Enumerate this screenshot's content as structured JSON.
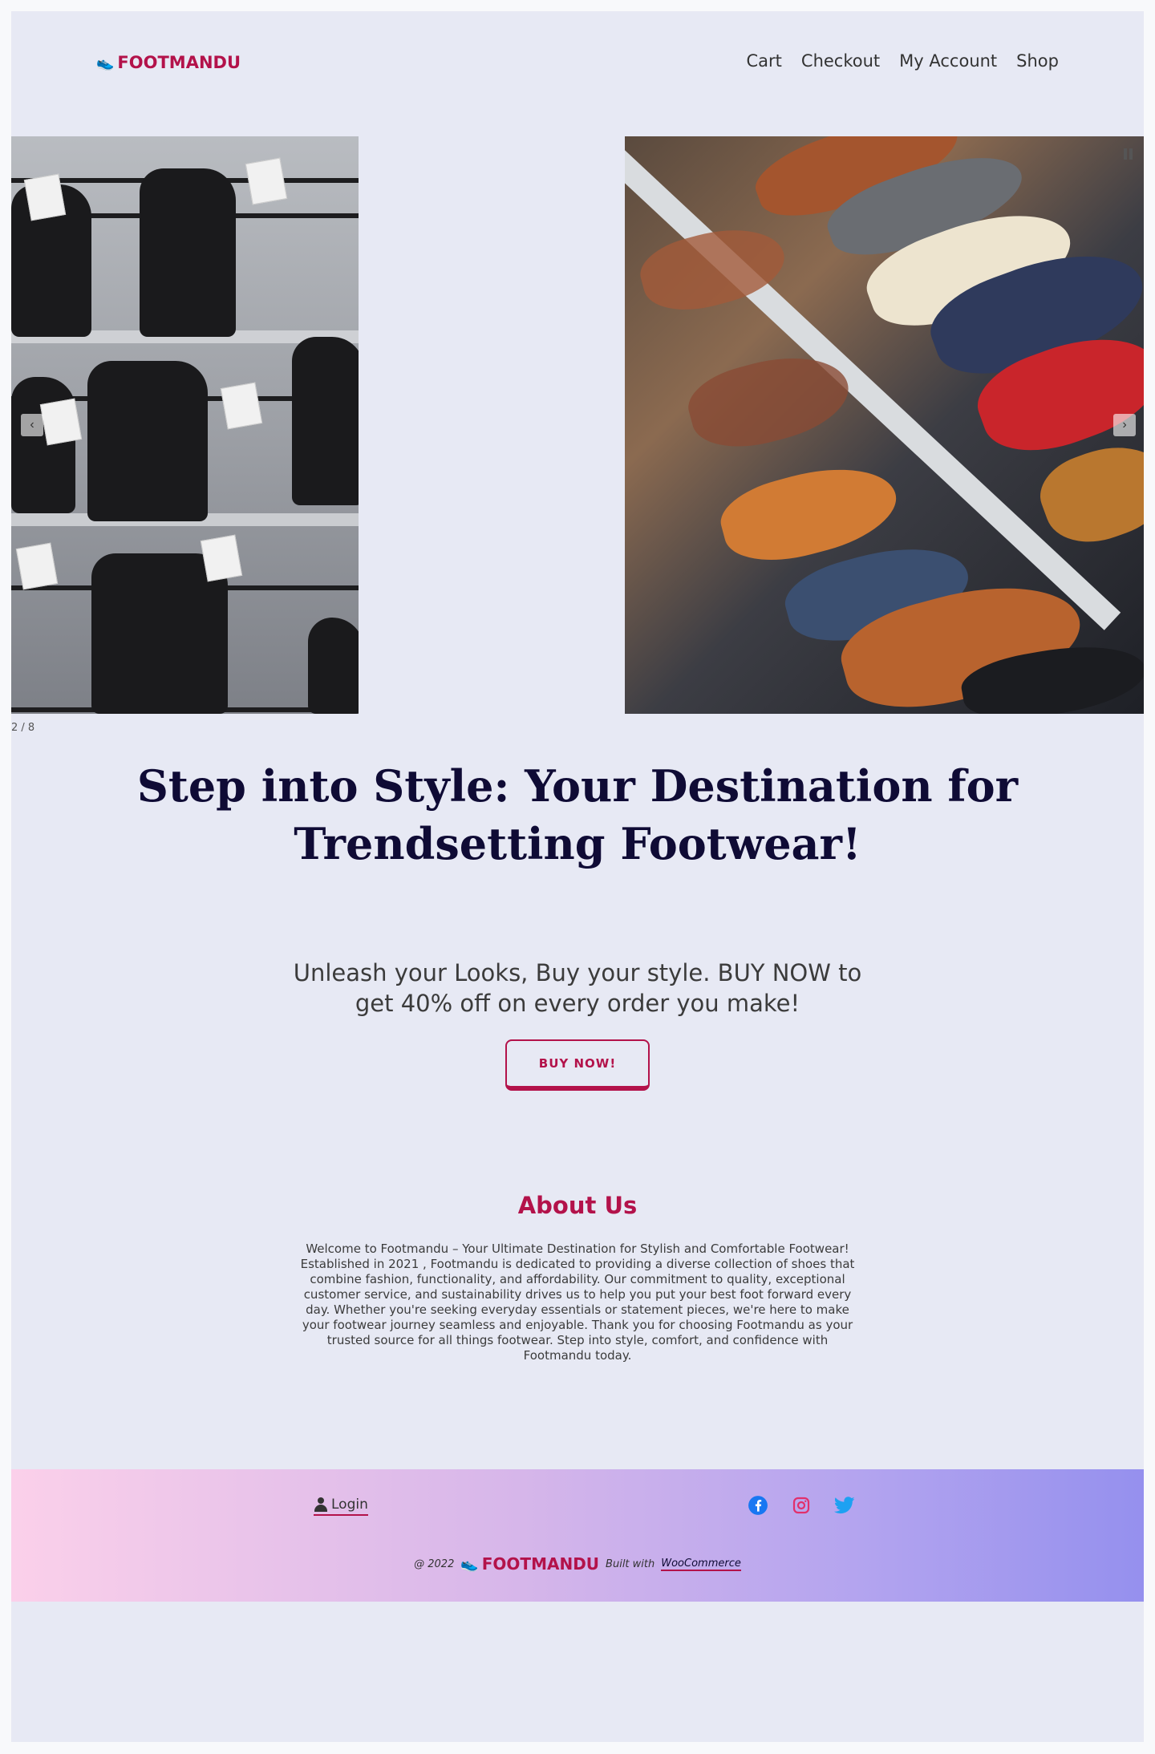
{
  "site": {
    "logo": "FOOTMANDU"
  },
  "nav": [
    {
      "label": "Cart"
    },
    {
      "label": "Checkout"
    },
    {
      "label": "My Account"
    },
    {
      "label": "Shop"
    }
  ],
  "slider": {
    "counter": "2 / 8",
    "prev_icon": "chevron-left-icon",
    "next_icon": "chevron-right-icon",
    "pause_icon": "pause-icon"
  },
  "hero": {
    "title": "Step into Style: Your Destination for Trendsetting Footwear!",
    "subtitle": "Unleash your Looks, Buy your style. BUY NOW to get 40% off on every order you make!",
    "cta": "BUY NOW!"
  },
  "about": {
    "title": "About Us",
    "text": "Welcome to Footmandu – Your Ultimate Destination for Stylish and Comfortable Footwear! Established in 2021 , Footmandu is dedicated to providing a diverse collection of shoes that combine fashion, functionality, and affordability. Our commitment to quality, exceptional customer service, and sustainability drives us to help you put your best foot forward every day. Whether you're seeking everyday essentials or statement pieces, we're here to make your footwear journey seamless and enjoyable. Thank you for choosing Footmandu as your trusted source for all things footwear. Step into style, comfort, and confidence with Footmandu today."
  },
  "footer": {
    "login": "Login",
    "copyright": "@ 2022",
    "logo": "FOOTMANDU",
    "built_with": "Built with",
    "woocommerce": "WooCommerce",
    "socials": [
      {
        "name": "facebook-icon",
        "color": "#1877f2"
      },
      {
        "name": "instagram-icon",
        "color": "#e1306c"
      },
      {
        "name": "twitter-icon",
        "color": "#1da1f2"
      }
    ]
  },
  "colors": {
    "brand": "#b3124a",
    "heading": "#0f0b35",
    "background": "#e7e9f4"
  }
}
